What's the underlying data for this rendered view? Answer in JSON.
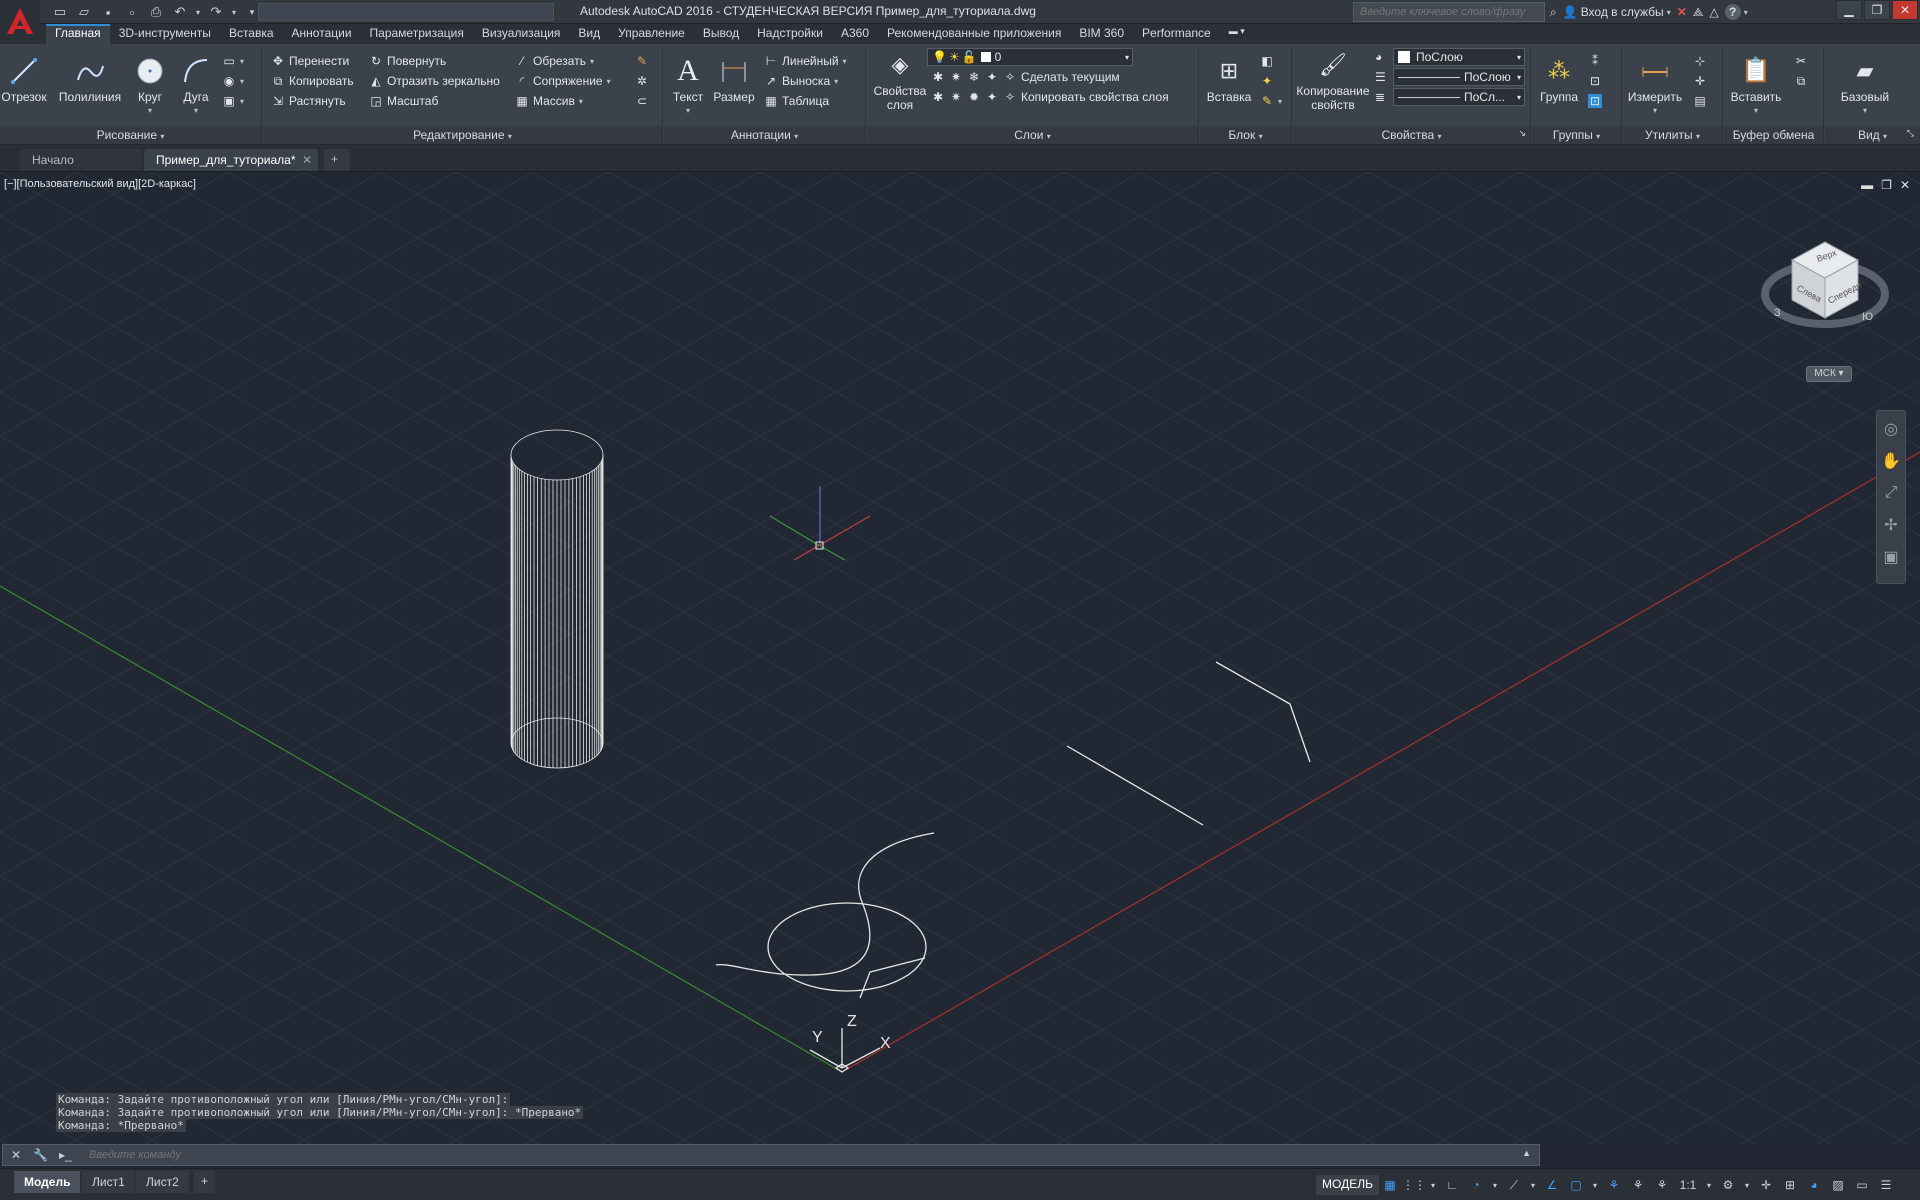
{
  "title": {
    "app_title": "Autodesk AutoCAD 2016 - СТУДЕНЧЕСКАЯ ВЕРСИЯ    Пример_для_туториала.dwg",
    "search_placeholder": "Введите ключевое слово/фразу",
    "signin": "Вход в службы",
    "help": "?"
  },
  "ribbon_tabs": [
    "Главная",
    "3D-инструменты",
    "Вставка",
    "Аннотации",
    "Параметризация",
    "Визуализация",
    "Вид",
    "Управление",
    "Вывод",
    "Надстройки",
    "A360",
    "Рекомендованные приложения",
    "BIM 360",
    "Performance"
  ],
  "panels": {
    "draw": {
      "label": "Рисование",
      "line": "Отрезок",
      "polyline": "Полилиния",
      "circle": "Круг",
      "arc": "Дуга"
    },
    "modify": {
      "label": "Редактирование",
      "move": "Перенести",
      "rotate": "Повернуть",
      "trim": "Обрезать",
      "copy": "Копировать",
      "mirror": "Отразить зеркально",
      "fillet": "Сопряжение",
      "stretch": "Растянуть",
      "scale": "Масштаб",
      "array": "Массив"
    },
    "annotation": {
      "label": "Аннотации",
      "text": "Текст",
      "dimension": "Размер",
      "linear": "Линейный",
      "leader": "Выноска",
      "table": "Таблица"
    },
    "layers": {
      "label": "Слои",
      "layer_props_1": "Свойства",
      "layer_props_2": "слоя",
      "layer_value": "0",
      "make_current": "Сделать текущим",
      "match_layer": "Копировать свойства слоя"
    },
    "block": {
      "label": "Блок",
      "insert": "Вставка"
    },
    "properties": {
      "label": "Свойства",
      "match_props_1": "Копирование",
      "match_props_2": "свойств",
      "color": "ПоСлою",
      "linetype": "ПоСлою",
      "lineweight": "ПоСл..."
    },
    "groups": {
      "label": "Группы",
      "group": "Группа"
    },
    "utilities": {
      "label": "Утилиты",
      "measure": "Измерить"
    },
    "clipboard": {
      "label": "Буфер обмена",
      "paste": "Вставить"
    },
    "view": {
      "label": "Вид",
      "base": "Базовый"
    }
  },
  "doc_tabs": [
    "Начало",
    "Пример_для_туториала*"
  ],
  "viewport": {
    "label": "[−][Пользовательский вид][2D-каркас]",
    "viewcube_top": "Верх",
    "viewcube_left": "Слева",
    "viewcube_front": "Спереди",
    "compass_w": "З",
    "compass_s": "Ю",
    "ucs_button": "МСК",
    "ucs_x": "X",
    "ucs_y": "Y",
    "ucs_z": "Z"
  },
  "command": {
    "history": [
      "Команда: Задайте противоположный угол или [Линия/РМн-угол/СМн-угол]:",
      "Команда: Задайте противоположный угол или [Линия/РМн-угол/СМн-угол]: *Прервано*",
      "Команда: *Прервано*"
    ],
    "placeholder": "Введите команду"
  },
  "status": {
    "layout_tabs": [
      "Модель",
      "Лист1",
      "Лист2"
    ],
    "model_button": "МОДЕЛЬ",
    "scale": "1:1"
  },
  "colors": {
    "accent": "#2d8fd5",
    "background": "#222833",
    "x_axis": "#a8302c",
    "y_axis": "#3a8a2e"
  }
}
